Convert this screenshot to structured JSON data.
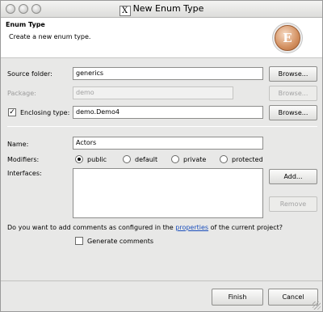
{
  "window": {
    "title": "New Enum Type",
    "x_logo": "X"
  },
  "header": {
    "title": "Enum Type",
    "description": "Create a new enum type.",
    "icon_letter": "E"
  },
  "form": {
    "source_folder_label": "Source folder:",
    "source_folder_value": "generics",
    "source_browse": "Browse...",
    "package_label": "Package:",
    "package_value": "demo",
    "package_browse": "Browse...",
    "enclosing_type_checked": true,
    "enclosing_type_label": "Enclosing type:",
    "enclosing_type_value": "demo.Demo4",
    "enclosing_browse": "Browse...",
    "name_label": "Name:",
    "name_value": "Actors",
    "modifiers_label": "Modifiers:",
    "modifiers": [
      {
        "label": "public",
        "selected": true
      },
      {
        "label": "default",
        "selected": false
      },
      {
        "label": "private",
        "selected": false
      },
      {
        "label": "protected",
        "selected": false
      }
    ],
    "interfaces_label": "Interfaces:",
    "add_button": "Add...",
    "remove_button": "Remove",
    "comments_question_prefix": "Do you want to add comments as configured in the ",
    "comments_link": "properties",
    "comments_question_suffix": " of the current project?",
    "generate_comments_checked": false,
    "generate_comments_label": "Generate comments"
  },
  "footer": {
    "finish": "Finish",
    "cancel": "Cancel"
  }
}
